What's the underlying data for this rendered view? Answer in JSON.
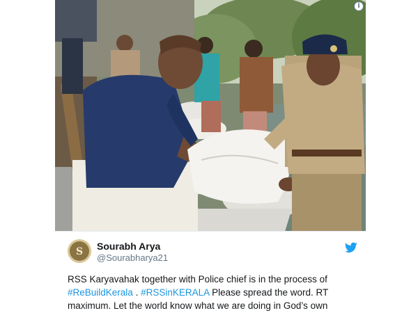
{
  "tweet": {
    "author": {
      "name": "Sourabh Arya",
      "handle": "@Sourabharya21"
    },
    "text": {
      "line1": "RSS Karyavahak together with Police chief is in the process of",
      "hashtag1": "#ReBuildKerala",
      "sep": " . ",
      "hashtag2": "#RSSinKERALA",
      "line2_rest": " Please spread the word. RT",
      "line3": "maximum. Let the world know what we are doing in God’s own"
    },
    "photo_icon": "info-icon",
    "brand_icon": "twitter-bird-icon",
    "colors": {
      "link": "#1b95e0",
      "text": "#14171a",
      "secondary": "#657786",
      "brand": "#1da1f2"
    }
  }
}
